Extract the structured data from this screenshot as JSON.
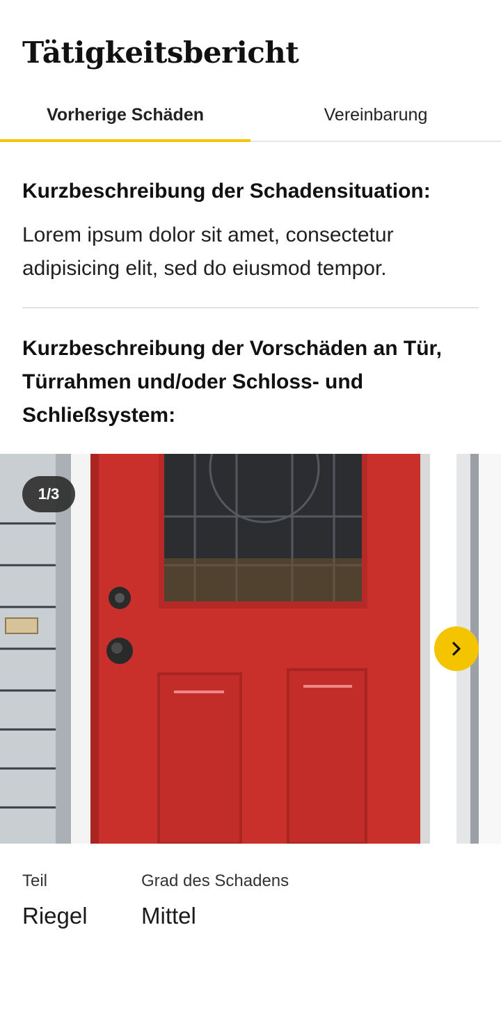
{
  "header": {
    "title": "Tätigkeitsbericht"
  },
  "tabs": [
    {
      "label": "Vorherige Schäden",
      "active": true
    },
    {
      "label": "Vereinbarung",
      "active": false
    }
  ],
  "summary": {
    "heading": "Kurzbeschreibung der Schadensituation:",
    "text": "Lorem ipsum dolor sit amet, consectetur adipisicing elit, sed do eiusmod tempor."
  },
  "prior_damage": {
    "heading": "Kurzbeschreibung der Vorschäden an Tür, Türrahmen und/oder Schloss- und Schließsystem:"
  },
  "gallery": {
    "counter": "1/3",
    "next_icon": "chevron-right-icon",
    "image": "red-front-door-photo"
  },
  "details": [
    {
      "label": "Teil",
      "value": "Riegel"
    },
    {
      "label": "Grad des Schadens",
      "value": "Mittel"
    }
  ],
  "colors": {
    "accent": "#f5c400",
    "door": "#c9302c",
    "divider": "#e3e3e3"
  }
}
